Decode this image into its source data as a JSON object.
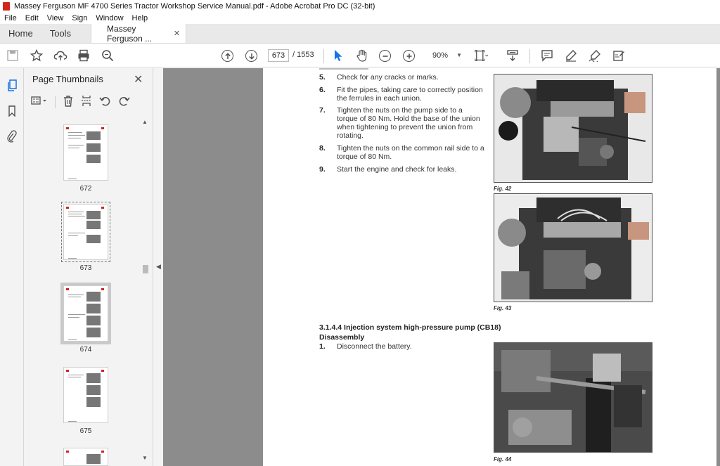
{
  "window": {
    "title": "Massey Ferguson MF 4700 Series Tractor Workshop Service Manual.pdf - Adobe Acrobat Pro DC (32-bit)"
  },
  "menu": [
    "File",
    "Edit",
    "View",
    "Sign",
    "Window",
    "Help"
  ],
  "tabs": {
    "home": "Home",
    "tools": "Tools",
    "document": "Massey Ferguson ...",
    "close": "✕"
  },
  "toolbar": {
    "current_page": "673",
    "page_separator": "/ 1553",
    "zoom": "90%"
  },
  "panel": {
    "title": "Page Thumbnails",
    "thumbnails": [
      {
        "label": "672"
      },
      {
        "label": "673"
      },
      {
        "label": "674"
      },
      {
        "label": "675"
      }
    ]
  },
  "document": {
    "steps": [
      {
        "num": "5.",
        "text": "Check for any cracks or marks."
      },
      {
        "num": "6.",
        "text": "Fit the pipes, taking care to correctly position the ferrules in each union."
      },
      {
        "num": "7.",
        "text": "Tighten the nuts on the pump side to a torque of 80 Nm. Hold the base of the union when tightening to prevent the union from rotating."
      },
      {
        "num": "8.",
        "text": "Tighten the nuts on the common rail side to a torque of 80 Nm."
      },
      {
        "num": "9.",
        "text": "Start the engine and check for leaks."
      }
    ],
    "section_title": "3.1.4.4  Injection system high-pressure pump (CB18)",
    "section_subtitle": "Disassembly",
    "section_steps": [
      {
        "num": "1.",
        "text": "Disconnect the battery."
      }
    ],
    "figures": [
      {
        "caption": "Fig. 42"
      },
      {
        "caption": "Fig. 43"
      },
      {
        "caption": "Fig. 44"
      }
    ]
  },
  "colors": {
    "acrobat_red": "#d4251c",
    "doc_background": "#8c8c8c",
    "selection_blue": "#1473e6"
  }
}
